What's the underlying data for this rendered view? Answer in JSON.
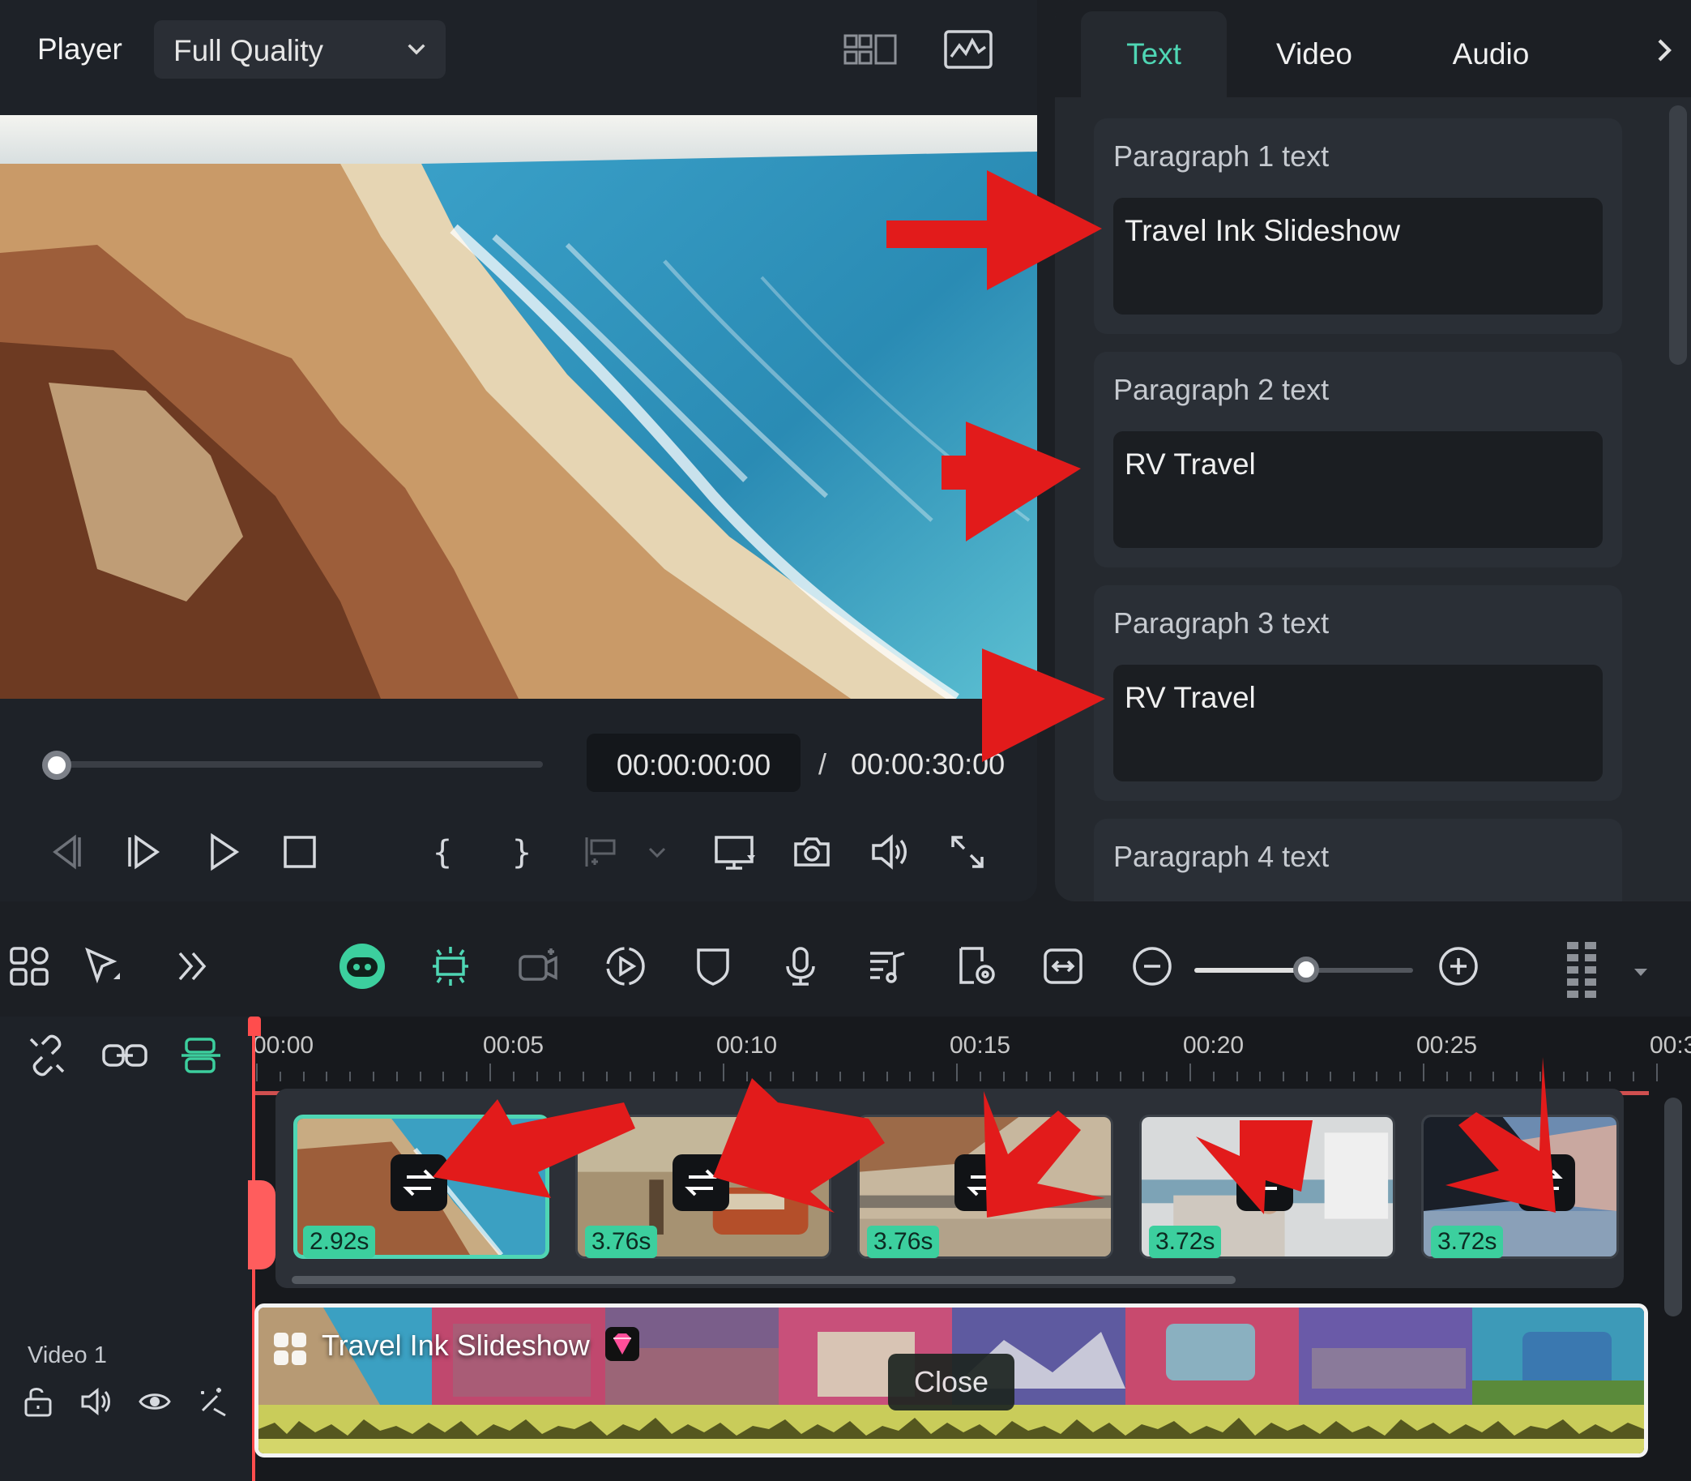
{
  "player": {
    "label": "Player",
    "quality": "Full Quality",
    "timecode_current": "00:00:00:00",
    "timecode_separator": "/",
    "timecode_total": "00:00:30:00",
    "progress": 0
  },
  "inspector": {
    "tabs": [
      {
        "label": "Text",
        "active": true
      },
      {
        "label": "Video",
        "active": false
      },
      {
        "label": "Audio",
        "active": false
      }
    ],
    "paragraphs": [
      {
        "title": "Paragraph 1 text",
        "value": "Travel Ink Slideshow"
      },
      {
        "title": "Paragraph 2 text",
        "value": "RV Travel"
      },
      {
        "title": "Paragraph 3 text",
        "value": "RV Travel"
      },
      {
        "title": "Paragraph 4 text",
        "value": ""
      }
    ]
  },
  "timeline": {
    "ruler": [
      "00:00",
      "00:05",
      "00:10",
      "00:15",
      "00:20",
      "00:25",
      "00:3"
    ],
    "scene_clips": [
      {
        "duration": "2.92s",
        "selected": true
      },
      {
        "duration": "3.76s",
        "selected": false
      },
      {
        "duration": "3.76s",
        "selected": false
      },
      {
        "duration": "3.72s",
        "selected": false
      },
      {
        "duration": "3.72s",
        "selected": false
      }
    ],
    "track_label": "Video 1",
    "main_clip_title": "Travel Ink Slideshow",
    "close_label": "Close",
    "zoom_level": 0.5
  },
  "colors": {
    "accent": "#4fd6b4",
    "annotation_arrow": "#e21b1b",
    "playhead": "#ff4d4d",
    "waveform": "#c9cc5a"
  }
}
